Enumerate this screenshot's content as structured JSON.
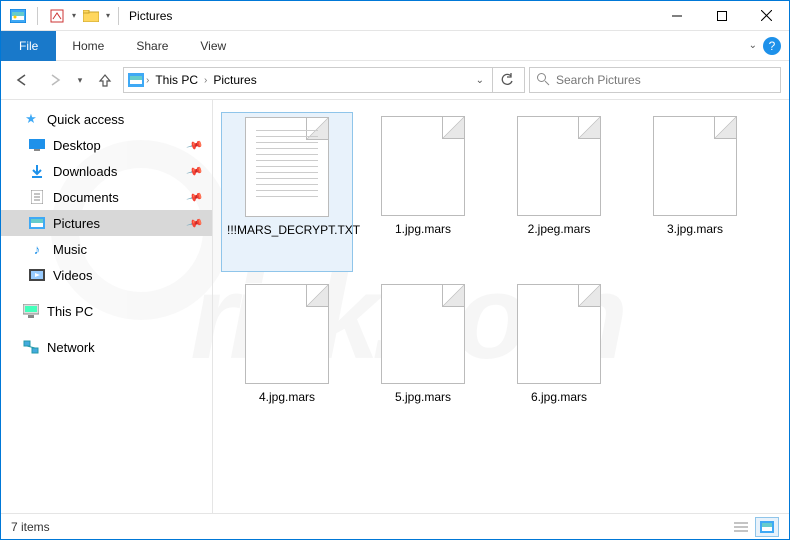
{
  "window": {
    "title": "Pictures"
  },
  "ribbon": {
    "file": "File",
    "tabs": [
      "Home",
      "Share",
      "View"
    ]
  },
  "breadcrumb": {
    "items": [
      "This PC",
      "Pictures"
    ]
  },
  "search": {
    "placeholder": "Search Pictures",
    "icon": "search-icon"
  },
  "sidebar": {
    "quick_access": {
      "label": "Quick access",
      "items": [
        {
          "label": "Desktop",
          "icon": "desktop-icon",
          "pinned": true
        },
        {
          "label": "Downloads",
          "icon": "downloads-icon",
          "pinned": true
        },
        {
          "label": "Documents",
          "icon": "documents-icon",
          "pinned": true
        },
        {
          "label": "Pictures",
          "icon": "pictures-icon",
          "pinned": true,
          "selected": true
        },
        {
          "label": "Music",
          "icon": "music-icon",
          "pinned": false
        },
        {
          "label": "Videos",
          "icon": "videos-icon",
          "pinned": false
        }
      ]
    },
    "this_pc": {
      "label": "This PC"
    },
    "network": {
      "label": "Network"
    }
  },
  "files": [
    {
      "name": "!!!MARS_DECRYPT.TXT",
      "type": "txt",
      "selected": true
    },
    {
      "name": "1.jpg.mars",
      "type": "blank"
    },
    {
      "name": "2.jpeg.mars",
      "type": "blank"
    },
    {
      "name": "3.jpg.mars",
      "type": "blank"
    },
    {
      "name": "4.jpg.mars",
      "type": "blank"
    },
    {
      "name": "5.jpg.mars",
      "type": "blank"
    },
    {
      "name": "6.jpg.mars",
      "type": "blank"
    }
  ],
  "status": {
    "text": "7 items"
  },
  "watermark": {
    "text": "risk.com"
  }
}
